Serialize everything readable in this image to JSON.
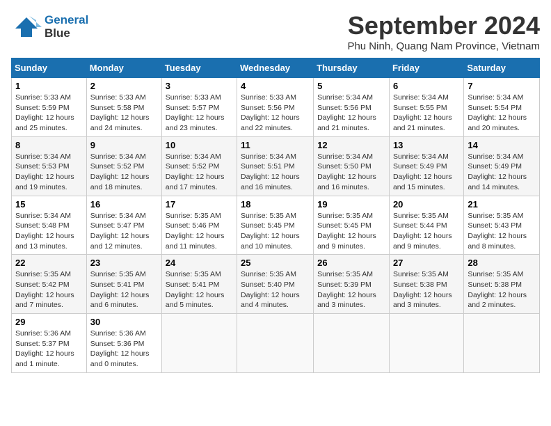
{
  "header": {
    "logo_line1": "General",
    "logo_line2": "Blue",
    "month": "September 2024",
    "location": "Phu Ninh, Quang Nam Province, Vietnam"
  },
  "weekdays": [
    "Sunday",
    "Monday",
    "Tuesday",
    "Wednesday",
    "Thursday",
    "Friday",
    "Saturday"
  ],
  "weeks": [
    [
      {
        "day": "1",
        "sunrise": "5:33 AM",
        "sunset": "5:59 PM",
        "daylight": "12 hours and 25 minutes."
      },
      {
        "day": "2",
        "sunrise": "5:33 AM",
        "sunset": "5:58 PM",
        "daylight": "12 hours and 24 minutes."
      },
      {
        "day": "3",
        "sunrise": "5:33 AM",
        "sunset": "5:57 PM",
        "daylight": "12 hours and 23 minutes."
      },
      {
        "day": "4",
        "sunrise": "5:33 AM",
        "sunset": "5:56 PM",
        "daylight": "12 hours and 22 minutes."
      },
      {
        "day": "5",
        "sunrise": "5:34 AM",
        "sunset": "5:56 PM",
        "daylight": "12 hours and 21 minutes."
      },
      {
        "day": "6",
        "sunrise": "5:34 AM",
        "sunset": "5:55 PM",
        "daylight": "12 hours and 21 minutes."
      },
      {
        "day": "7",
        "sunrise": "5:34 AM",
        "sunset": "5:54 PM",
        "daylight": "12 hours and 20 minutes."
      }
    ],
    [
      {
        "day": "8",
        "sunrise": "5:34 AM",
        "sunset": "5:53 PM",
        "daylight": "12 hours and 19 minutes."
      },
      {
        "day": "9",
        "sunrise": "5:34 AM",
        "sunset": "5:52 PM",
        "daylight": "12 hours and 18 minutes."
      },
      {
        "day": "10",
        "sunrise": "5:34 AM",
        "sunset": "5:52 PM",
        "daylight": "12 hours and 17 minutes."
      },
      {
        "day": "11",
        "sunrise": "5:34 AM",
        "sunset": "5:51 PM",
        "daylight": "12 hours and 16 minutes."
      },
      {
        "day": "12",
        "sunrise": "5:34 AM",
        "sunset": "5:50 PM",
        "daylight": "12 hours and 16 minutes."
      },
      {
        "day": "13",
        "sunrise": "5:34 AM",
        "sunset": "5:49 PM",
        "daylight": "12 hours and 15 minutes."
      },
      {
        "day": "14",
        "sunrise": "5:34 AM",
        "sunset": "5:49 PM",
        "daylight": "12 hours and 14 minutes."
      }
    ],
    [
      {
        "day": "15",
        "sunrise": "5:34 AM",
        "sunset": "5:48 PM",
        "daylight": "12 hours and 13 minutes."
      },
      {
        "day": "16",
        "sunrise": "5:34 AM",
        "sunset": "5:47 PM",
        "daylight": "12 hours and 12 minutes."
      },
      {
        "day": "17",
        "sunrise": "5:35 AM",
        "sunset": "5:46 PM",
        "daylight": "12 hours and 11 minutes."
      },
      {
        "day": "18",
        "sunrise": "5:35 AM",
        "sunset": "5:45 PM",
        "daylight": "12 hours and 10 minutes."
      },
      {
        "day": "19",
        "sunrise": "5:35 AM",
        "sunset": "5:45 PM",
        "daylight": "12 hours and 9 minutes."
      },
      {
        "day": "20",
        "sunrise": "5:35 AM",
        "sunset": "5:44 PM",
        "daylight": "12 hours and 9 minutes."
      },
      {
        "day": "21",
        "sunrise": "5:35 AM",
        "sunset": "5:43 PM",
        "daylight": "12 hours and 8 minutes."
      }
    ],
    [
      {
        "day": "22",
        "sunrise": "5:35 AM",
        "sunset": "5:42 PM",
        "daylight": "12 hours and 7 minutes."
      },
      {
        "day": "23",
        "sunrise": "5:35 AM",
        "sunset": "5:41 PM",
        "daylight": "12 hours and 6 minutes."
      },
      {
        "day": "24",
        "sunrise": "5:35 AM",
        "sunset": "5:41 PM",
        "daylight": "12 hours and 5 minutes."
      },
      {
        "day": "25",
        "sunrise": "5:35 AM",
        "sunset": "5:40 PM",
        "daylight": "12 hours and 4 minutes."
      },
      {
        "day": "26",
        "sunrise": "5:35 AM",
        "sunset": "5:39 PM",
        "daylight": "12 hours and 3 minutes."
      },
      {
        "day": "27",
        "sunrise": "5:35 AM",
        "sunset": "5:38 PM",
        "daylight": "12 hours and 3 minutes."
      },
      {
        "day": "28",
        "sunrise": "5:35 AM",
        "sunset": "5:38 PM",
        "daylight": "12 hours and 2 minutes."
      }
    ],
    [
      {
        "day": "29",
        "sunrise": "5:36 AM",
        "sunset": "5:37 PM",
        "daylight": "12 hours and 1 minute."
      },
      {
        "day": "30",
        "sunrise": "5:36 AM",
        "sunset": "5:36 PM",
        "daylight": "12 hours and 0 minutes."
      },
      null,
      null,
      null,
      null,
      null
    ]
  ]
}
